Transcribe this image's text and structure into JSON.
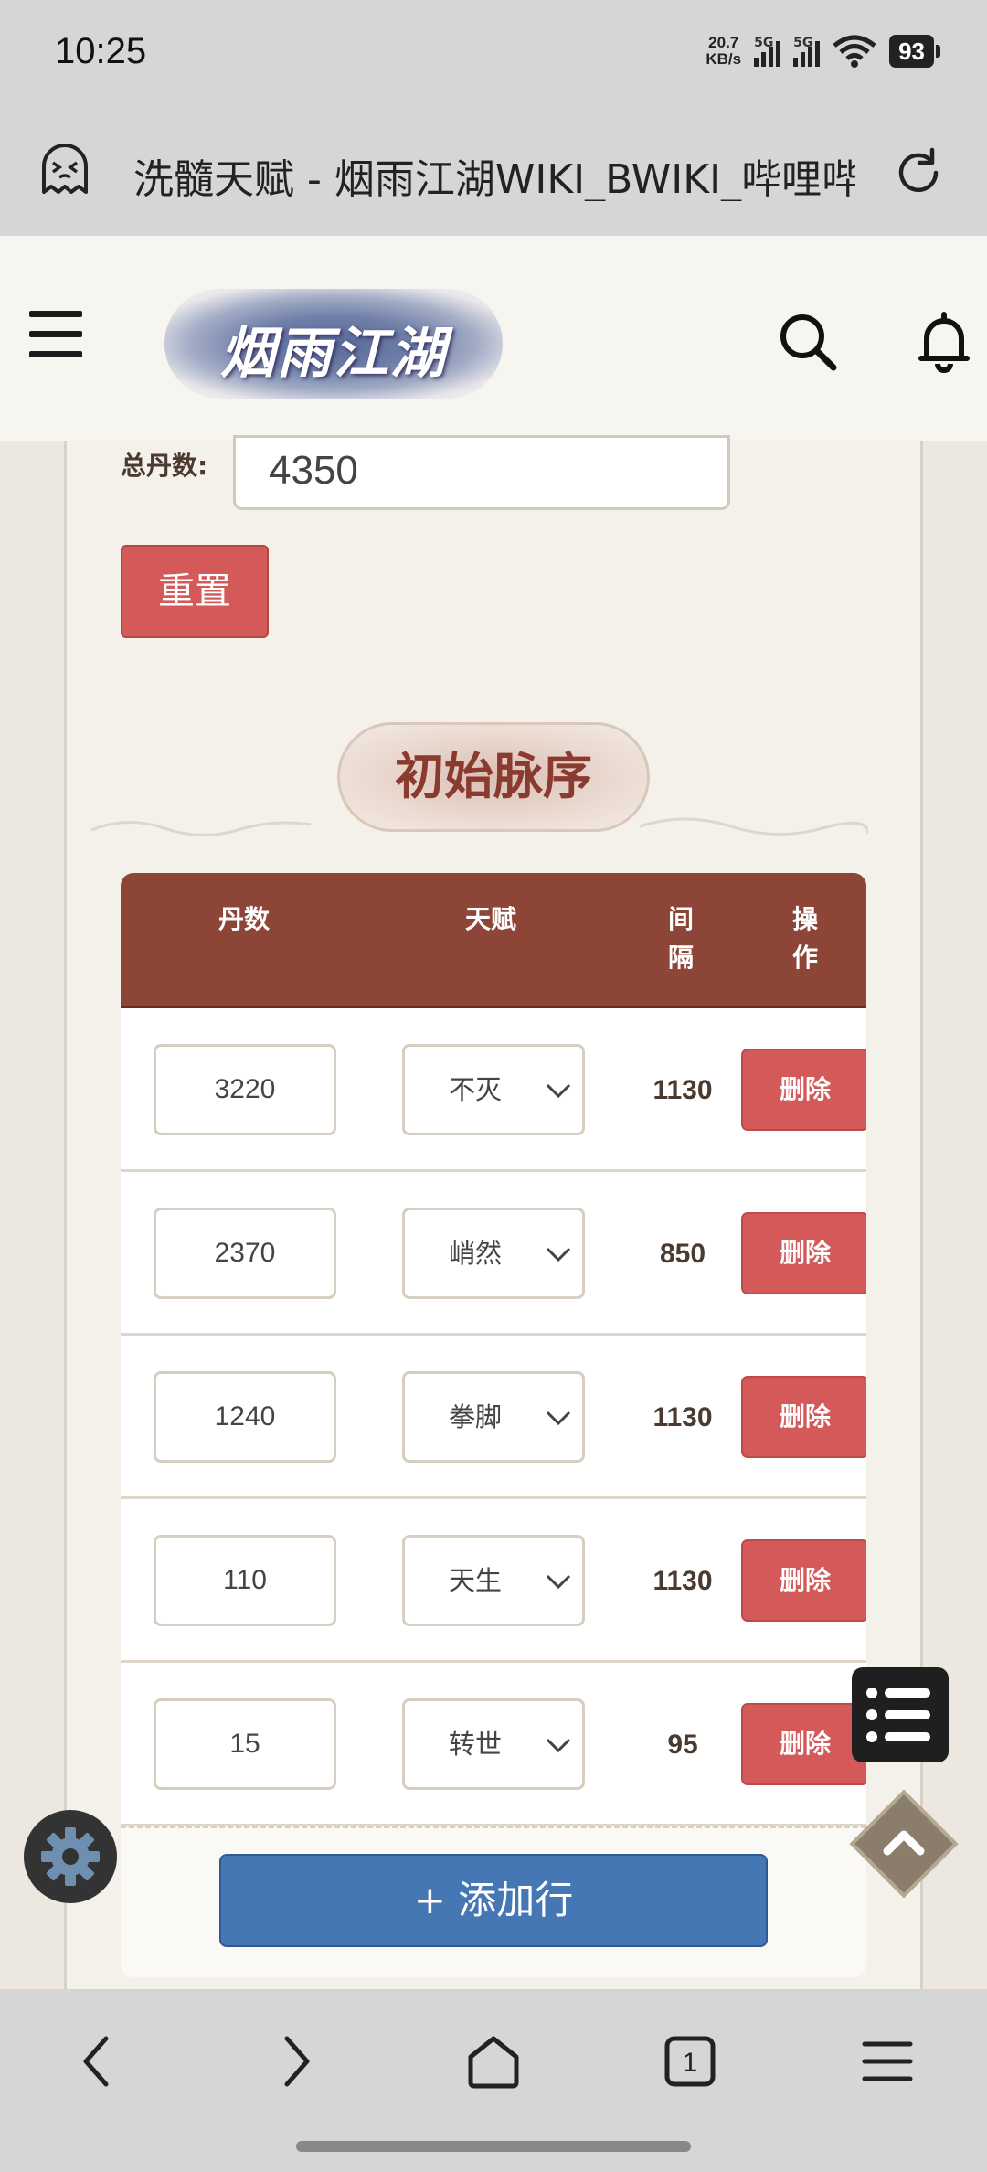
{
  "status_bar": {
    "time": "10:25",
    "net_speed": "20.7",
    "net_speed_unit": "KB/s",
    "sim1": "5G",
    "sim2": "5G",
    "battery": "93"
  },
  "browser": {
    "page_title": "洗髓天赋 - 烟雨江湖WIKI_BWIKI_哔哩哔哩"
  },
  "site_header": {
    "logo_text": "烟雨江湖"
  },
  "form": {
    "total_label": "总丹数:",
    "total_value": "4350",
    "reset_label": "重置"
  },
  "section": {
    "title": "初始脉序"
  },
  "table": {
    "headers": {
      "pills": "丹数",
      "talent": "天赋",
      "interval": "间隔",
      "action": "操作"
    },
    "rows": [
      {
        "pills": "3220",
        "talent": "不灭",
        "interval": "1130",
        "action": "删除"
      },
      {
        "pills": "2370",
        "talent": "峭然",
        "interval": "850",
        "action": "删除"
      },
      {
        "pills": "1240",
        "talent": "拳脚",
        "interval": "1130",
        "action": "删除"
      },
      {
        "pills": "110",
        "talent": "天生",
        "interval": "1130",
        "action": "删除"
      },
      {
        "pills": "15",
        "talent": "转世",
        "interval": "95",
        "action": "删除"
      }
    ],
    "add_row_label": "+ 添加行"
  },
  "bottom_nav": {
    "tab_count": "1"
  },
  "icons": {
    "site": "ghost-face-icon",
    "reload": "reload-icon",
    "menu": "hamburger-icon",
    "search": "search-icon",
    "bell": "bell-icon",
    "settings": "gear-icon",
    "toc": "list-icon",
    "top": "chevron-up-icon"
  },
  "colors": {
    "table_header": "#8c4536",
    "danger_button": "#d45a5a",
    "primary_button": "#4577b5",
    "section_title_text": "#8a3a2e"
  }
}
